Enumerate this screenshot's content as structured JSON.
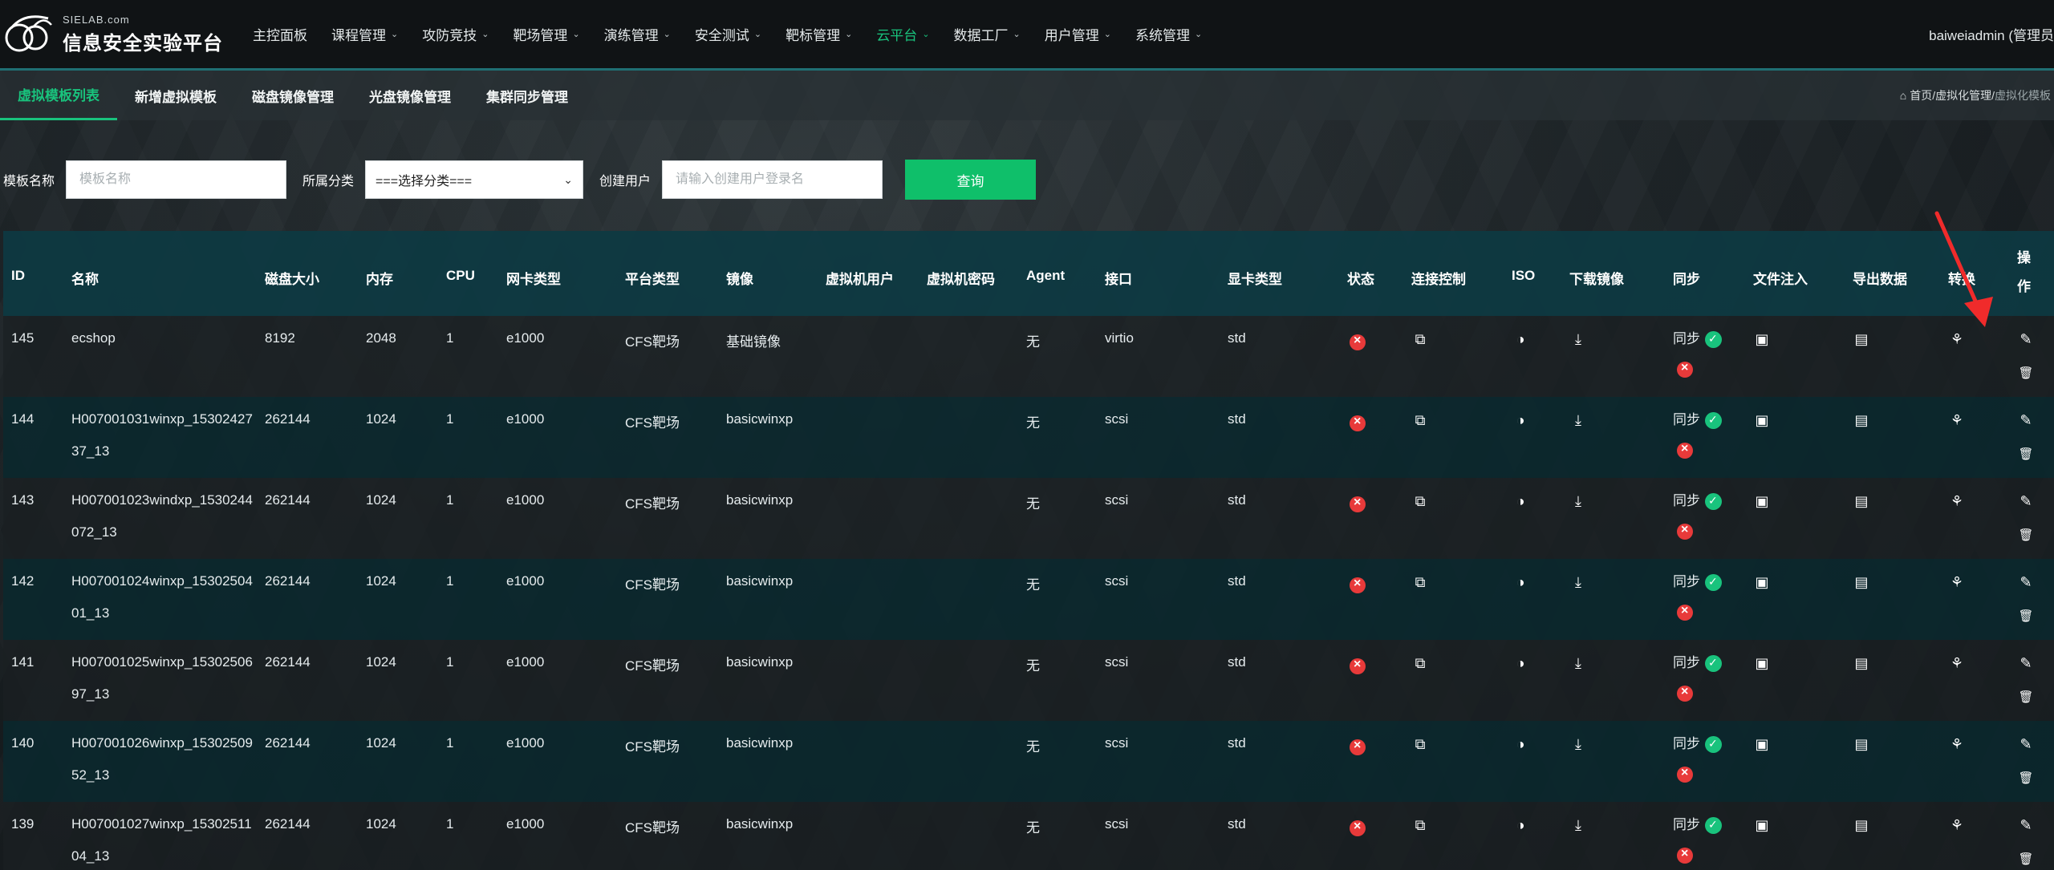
{
  "logo": {
    "sub": "SIELAB.com",
    "main": "信息安全实验平台"
  },
  "nav": [
    {
      "label": "主控面板",
      "caret": false,
      "active": false
    },
    {
      "label": "课程管理",
      "caret": true,
      "active": false
    },
    {
      "label": "攻防竞技",
      "caret": true,
      "active": false
    },
    {
      "label": "靶场管理",
      "caret": true,
      "active": false
    },
    {
      "label": "演练管理",
      "caret": true,
      "active": false
    },
    {
      "label": "安全测试",
      "caret": true,
      "active": false
    },
    {
      "label": "靶标管理",
      "caret": true,
      "active": false
    },
    {
      "label": "云平台",
      "caret": true,
      "active": true
    },
    {
      "label": "数据工厂",
      "caret": true,
      "active": false
    },
    {
      "label": "用户管理",
      "caret": true,
      "active": false
    },
    {
      "label": "系统管理",
      "caret": true,
      "active": false
    }
  ],
  "user": "baiweiadmin (管理员",
  "subtabs": [
    {
      "label": "虚拟模板列表",
      "active": true
    },
    {
      "label": "新增虚拟模板",
      "active": false
    },
    {
      "label": "磁盘镜像管理",
      "active": false
    },
    {
      "label": "光盘镜像管理",
      "active": false
    },
    {
      "label": "集群同步管理",
      "active": false
    }
  ],
  "breadcrumb": {
    "path": "首页/虚拟化管理/",
    "current": "虚拟化模板"
  },
  "search": {
    "name_label": "模板名称",
    "name_placeholder": "模板名称",
    "category_label": "所属分类",
    "category_value": "===选择分类===",
    "creator_label": "创建用户",
    "creator_placeholder": "请输入创建用户登录名",
    "submit": "查询"
  },
  "table": {
    "headers": [
      "ID",
      "名称",
      "磁盘大小",
      "内存",
      "CPU",
      "网卡类型",
      "平台类型",
      "镜像",
      "虚拟机用户",
      "虚拟机密码",
      "Agent",
      "接口",
      "显卡类型",
      "状态",
      "连接控制",
      "ISO",
      "下载镜像",
      "同步",
      "文件注入",
      "导出数据",
      "转换",
      "操作"
    ],
    "sync_label": "同步",
    "rows": [
      {
        "id": "145",
        "name": "ecshop",
        "disk": "8192",
        "mem": "2048",
        "cpu": "1",
        "nic": "e1000",
        "platform": "CFS靶场",
        "image": "基础镜像",
        "vmuser": "",
        "vmpass": "",
        "agent": "无",
        "iface": "virtio",
        "gpu": "std"
      },
      {
        "id": "144",
        "name": "H007001031winxp_1530242737_13",
        "disk": "262144",
        "mem": "1024",
        "cpu": "1",
        "nic": "e1000",
        "platform": "CFS靶场",
        "image": "basicwinxp",
        "vmuser": "",
        "vmpass": "",
        "agent": "无",
        "iface": "scsi",
        "gpu": "std"
      },
      {
        "id": "143",
        "name": "H007001023windxp_1530244072_13",
        "disk": "262144",
        "mem": "1024",
        "cpu": "1",
        "nic": "e1000",
        "platform": "CFS靶场",
        "image": "basicwinxp",
        "vmuser": "",
        "vmpass": "",
        "agent": "无",
        "iface": "scsi",
        "gpu": "std"
      },
      {
        "id": "142",
        "name": "H007001024winxp_1530250401_13",
        "disk": "262144",
        "mem": "1024",
        "cpu": "1",
        "nic": "e1000",
        "platform": "CFS靶场",
        "image": "basicwinxp",
        "vmuser": "",
        "vmpass": "",
        "agent": "无",
        "iface": "scsi",
        "gpu": "std"
      },
      {
        "id": "141",
        "name": "H007001025winxp_1530250697_13",
        "disk": "262144",
        "mem": "1024",
        "cpu": "1",
        "nic": "e1000",
        "platform": "CFS靶场",
        "image": "basicwinxp",
        "vmuser": "",
        "vmpass": "",
        "agent": "无",
        "iface": "scsi",
        "gpu": "std"
      },
      {
        "id": "140",
        "name": "H007001026winxp_1530250952_13",
        "disk": "262144",
        "mem": "1024",
        "cpu": "1",
        "nic": "e1000",
        "platform": "CFS靶场",
        "image": "basicwinxp",
        "vmuser": "",
        "vmpass": "",
        "agent": "无",
        "iface": "scsi",
        "gpu": "std"
      },
      {
        "id": "139",
        "name": "H007001027winxp_1530251104_13",
        "disk": "262144",
        "mem": "1024",
        "cpu": "1",
        "nic": "e1000",
        "platform": "CFS靶场",
        "image": "basicwinxp",
        "vmuser": "",
        "vmpass": "",
        "agent": "无",
        "iface": "scsi",
        "gpu": "std"
      }
    ]
  },
  "colors": {
    "accent": "#19c37d",
    "error": "#e83a3a",
    "header": "#0d3a42",
    "annotation_arrow": "#f02b2b"
  }
}
